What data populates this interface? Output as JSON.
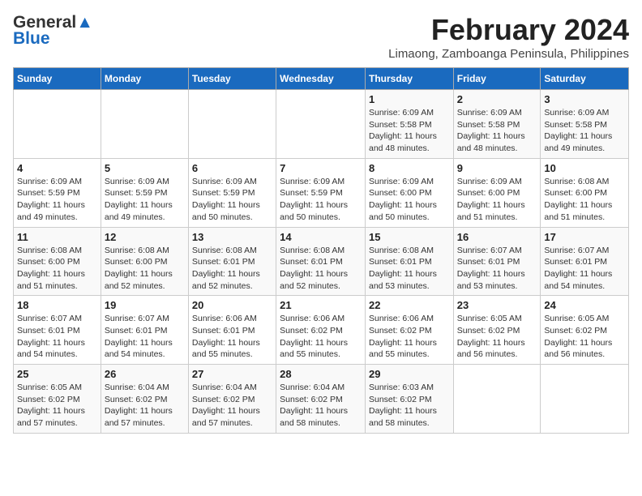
{
  "logo": {
    "line1": "General",
    "line2": "Blue"
  },
  "title": "February 2024",
  "location": "Limaong, Zamboanga Peninsula, Philippines",
  "days_of_week": [
    "Sunday",
    "Monday",
    "Tuesday",
    "Wednesday",
    "Thursday",
    "Friday",
    "Saturday"
  ],
  "weeks": [
    [
      {
        "day": "",
        "content": ""
      },
      {
        "day": "",
        "content": ""
      },
      {
        "day": "",
        "content": ""
      },
      {
        "day": "",
        "content": ""
      },
      {
        "day": "1",
        "content": "Sunrise: 6:09 AM\nSunset: 5:58 PM\nDaylight: 11 hours\nand 48 minutes."
      },
      {
        "day": "2",
        "content": "Sunrise: 6:09 AM\nSunset: 5:58 PM\nDaylight: 11 hours\nand 48 minutes."
      },
      {
        "day": "3",
        "content": "Sunrise: 6:09 AM\nSunset: 5:58 PM\nDaylight: 11 hours\nand 49 minutes."
      }
    ],
    [
      {
        "day": "4",
        "content": "Sunrise: 6:09 AM\nSunset: 5:59 PM\nDaylight: 11 hours\nand 49 minutes."
      },
      {
        "day": "5",
        "content": "Sunrise: 6:09 AM\nSunset: 5:59 PM\nDaylight: 11 hours\nand 49 minutes."
      },
      {
        "day": "6",
        "content": "Sunrise: 6:09 AM\nSunset: 5:59 PM\nDaylight: 11 hours\nand 50 minutes."
      },
      {
        "day": "7",
        "content": "Sunrise: 6:09 AM\nSunset: 5:59 PM\nDaylight: 11 hours\nand 50 minutes."
      },
      {
        "day": "8",
        "content": "Sunrise: 6:09 AM\nSunset: 6:00 PM\nDaylight: 11 hours\nand 50 minutes."
      },
      {
        "day": "9",
        "content": "Sunrise: 6:09 AM\nSunset: 6:00 PM\nDaylight: 11 hours\nand 51 minutes."
      },
      {
        "day": "10",
        "content": "Sunrise: 6:08 AM\nSunset: 6:00 PM\nDaylight: 11 hours\nand 51 minutes."
      }
    ],
    [
      {
        "day": "11",
        "content": "Sunrise: 6:08 AM\nSunset: 6:00 PM\nDaylight: 11 hours\nand 51 minutes."
      },
      {
        "day": "12",
        "content": "Sunrise: 6:08 AM\nSunset: 6:00 PM\nDaylight: 11 hours\nand 52 minutes."
      },
      {
        "day": "13",
        "content": "Sunrise: 6:08 AM\nSunset: 6:01 PM\nDaylight: 11 hours\nand 52 minutes."
      },
      {
        "day": "14",
        "content": "Sunrise: 6:08 AM\nSunset: 6:01 PM\nDaylight: 11 hours\nand 52 minutes."
      },
      {
        "day": "15",
        "content": "Sunrise: 6:08 AM\nSunset: 6:01 PM\nDaylight: 11 hours\nand 53 minutes."
      },
      {
        "day": "16",
        "content": "Sunrise: 6:07 AM\nSunset: 6:01 PM\nDaylight: 11 hours\nand 53 minutes."
      },
      {
        "day": "17",
        "content": "Sunrise: 6:07 AM\nSunset: 6:01 PM\nDaylight: 11 hours\nand 54 minutes."
      }
    ],
    [
      {
        "day": "18",
        "content": "Sunrise: 6:07 AM\nSunset: 6:01 PM\nDaylight: 11 hours\nand 54 minutes."
      },
      {
        "day": "19",
        "content": "Sunrise: 6:07 AM\nSunset: 6:01 PM\nDaylight: 11 hours\nand 54 minutes."
      },
      {
        "day": "20",
        "content": "Sunrise: 6:06 AM\nSunset: 6:01 PM\nDaylight: 11 hours\nand 55 minutes."
      },
      {
        "day": "21",
        "content": "Sunrise: 6:06 AM\nSunset: 6:02 PM\nDaylight: 11 hours\nand 55 minutes."
      },
      {
        "day": "22",
        "content": "Sunrise: 6:06 AM\nSunset: 6:02 PM\nDaylight: 11 hours\nand 55 minutes."
      },
      {
        "day": "23",
        "content": "Sunrise: 6:05 AM\nSunset: 6:02 PM\nDaylight: 11 hours\nand 56 minutes."
      },
      {
        "day": "24",
        "content": "Sunrise: 6:05 AM\nSunset: 6:02 PM\nDaylight: 11 hours\nand 56 minutes."
      }
    ],
    [
      {
        "day": "25",
        "content": "Sunrise: 6:05 AM\nSunset: 6:02 PM\nDaylight: 11 hours\nand 57 minutes."
      },
      {
        "day": "26",
        "content": "Sunrise: 6:04 AM\nSunset: 6:02 PM\nDaylight: 11 hours\nand 57 minutes."
      },
      {
        "day": "27",
        "content": "Sunrise: 6:04 AM\nSunset: 6:02 PM\nDaylight: 11 hours\nand 57 minutes."
      },
      {
        "day": "28",
        "content": "Sunrise: 6:04 AM\nSunset: 6:02 PM\nDaylight: 11 hours\nand 58 minutes."
      },
      {
        "day": "29",
        "content": "Sunrise: 6:03 AM\nSunset: 6:02 PM\nDaylight: 11 hours\nand 58 minutes."
      },
      {
        "day": "",
        "content": ""
      },
      {
        "day": "",
        "content": ""
      }
    ]
  ]
}
